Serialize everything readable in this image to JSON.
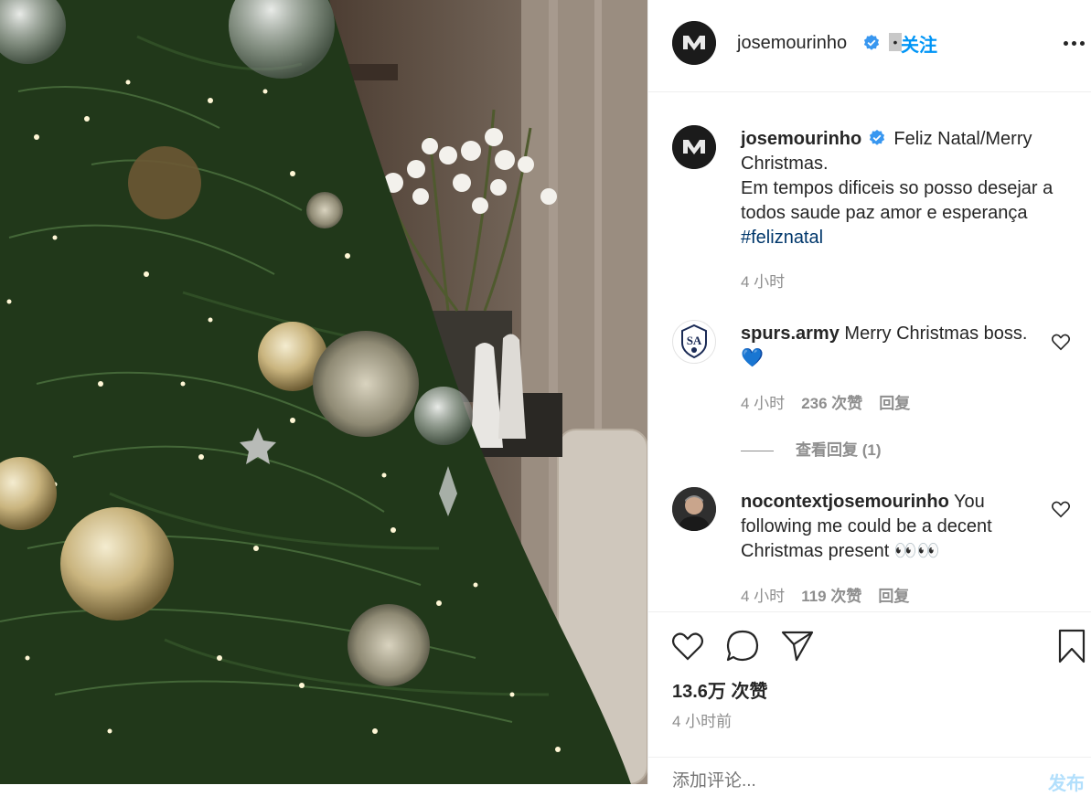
{
  "post": {
    "author": "josemourinho",
    "follow_label": "关注",
    "separator": "•",
    "caption_lines": [
      "Feliz Natal/Merry",
      "Christmas.",
      "Em tempos dificeis so posso desejar a",
      "todos saude paz amor e esperança"
    ],
    "hashtag": "#feliznatal",
    "caption_time": "4 小时",
    "likes": "13.6万 次赞",
    "time_ago": "4 小时前"
  },
  "comments": [
    {
      "user": "spurs.army",
      "text": "Merry Christmas boss.",
      "emoji": "💙",
      "time": "4 小时",
      "likes": "236 次赞",
      "reply_label": "回复",
      "view_replies": "查看回复 (1)"
    },
    {
      "user": "nocontextjosemourinho",
      "text_lines": [
        "You",
        "following me could be a decent",
        "Christmas present"
      ],
      "emoji": "👀👀",
      "time": "4 小时",
      "likes": "119 次赞",
      "reply_label": "回复"
    }
  ],
  "composer": {
    "placeholder": "添加评论...",
    "post_label": "发布"
  },
  "icons": {
    "verified": "verified-badge-icon",
    "more": "more-options-icon",
    "like": "heart-icon",
    "comment": "comment-bubble-icon",
    "share": "paper-plane-icon",
    "save": "bookmark-icon"
  },
  "colors": {
    "accent": "#0095f6",
    "hashtag": "#00376b",
    "muted": "#8e8e8e",
    "text": "#262626"
  }
}
